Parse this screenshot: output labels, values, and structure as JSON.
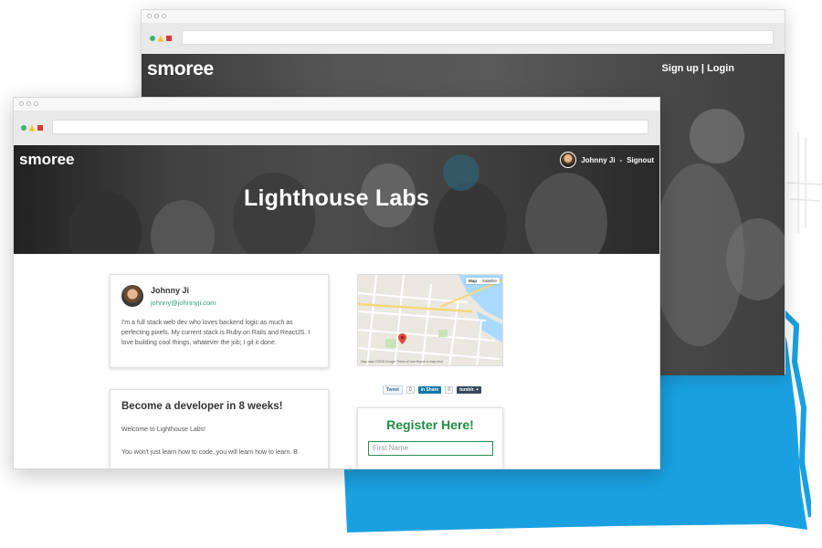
{
  "back_window": {
    "logo": "smoree",
    "auth_links": "Sign up | Login"
  },
  "front_window": {
    "logo": "smoree",
    "user": {
      "name": "Johnny Ji",
      "separator": "-",
      "signout": "Signout"
    },
    "hero_title": "Lighthouse Labs",
    "profile": {
      "name": "Johnny Ji",
      "email": "johnny@johnnyji.com",
      "bio": "I'm a full stack web dev who loves backend logic as much as perfecting pixels. My current stack is Ruby on Rails and ReactJS. I love building cool things, whatever the job; I git it done."
    },
    "course": {
      "title": "Become a developer in 8 weeks!",
      "intro": "Welcome to Lighthouse Labs!",
      "text": "You won't just learn how to code, you will learn how to learn. B"
    },
    "map": {
      "toggle": [
        "Map",
        "Satellite"
      ],
      "credit": "Map data ©2015 Google   Terms of Use   Report a map error"
    },
    "share": {
      "tweet": "Tweet",
      "tweet_count": "0",
      "linkedin": "in Share",
      "linkedin_count": "0",
      "tumblr": "tumblr. +"
    },
    "register": {
      "title": "Register Here!",
      "first_name_placeholder": "First Name"
    }
  },
  "colors": {
    "accent_blue": "#1aa0e0",
    "register_green": "#1e8c44",
    "email_green": "#2ea37a"
  }
}
